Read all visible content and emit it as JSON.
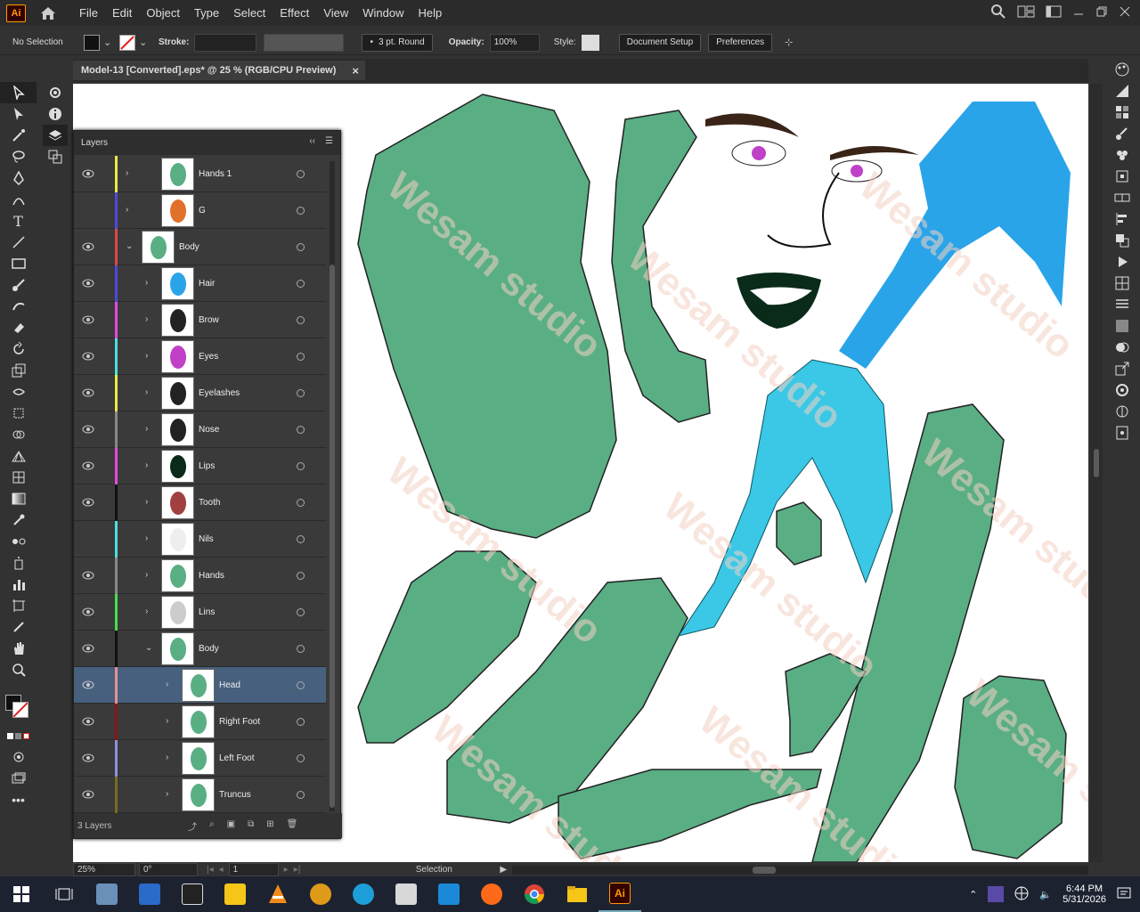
{
  "menu": {
    "logo": "Ai",
    "items": [
      "File",
      "Edit",
      "Object",
      "Type",
      "Select",
      "Effect",
      "View",
      "Window",
      "Help"
    ]
  },
  "control": {
    "selection": "No Selection",
    "stroke_label": "Stroke:",
    "brush_label": "3 pt. Round",
    "opacity_label": "Opacity:",
    "opacity_value": "100%",
    "style_label": "Style:",
    "document_setup": "Document Setup",
    "preferences": "Preferences"
  },
  "document": {
    "tab_title": "Model-13 [Converted].eps* @ 25 % (RGB/CPU Preview)",
    "close": "×"
  },
  "layers_panel": {
    "title": "Layers",
    "footer": "3 Layers",
    "rows": [
      {
        "name": "Hands 1",
        "color": "#e8e84a",
        "visible": true,
        "expanded": false,
        "selected": false
      },
      {
        "name": "G",
        "color": "#4a4adf",
        "visible": false,
        "expanded": false,
        "selected": false
      },
      {
        "name": "Body",
        "color": "#e04545",
        "visible": true,
        "expanded": true,
        "selected": false
      },
      {
        "name": "Hair",
        "color": "#4a4adf",
        "visible": true,
        "expanded": false,
        "selected": false
      },
      {
        "name": "Brow",
        "color": "#e04ae0",
        "visible": true,
        "expanded": false,
        "selected": false
      },
      {
        "name": "Eyes",
        "color": "#4ae0e0",
        "visible": true,
        "expanded": false,
        "selected": false
      },
      {
        "name": "Eyelashes",
        "color": "#e8e84a",
        "visible": true,
        "expanded": false,
        "selected": false
      },
      {
        "name": "Nose",
        "color": "#888888",
        "visible": true,
        "expanded": false,
        "selected": false
      },
      {
        "name": "Lips",
        "color": "#e04ae0",
        "visible": true,
        "expanded": false,
        "selected": false
      },
      {
        "name": "Tooth",
        "color": "#111111",
        "visible": true,
        "expanded": false,
        "selected": false
      },
      {
        "name": "Nils",
        "color": "#4ae0e0",
        "visible": false,
        "expanded": false,
        "selected": false
      },
      {
        "name": "Hands",
        "color": "#888888",
        "visible": true,
        "expanded": false,
        "selected": false
      },
      {
        "name": "Lins",
        "color": "#4ae04a",
        "visible": true,
        "expanded": false,
        "selected": false
      },
      {
        "name": "Body",
        "color": "#111111",
        "visible": true,
        "expanded": true,
        "selected": false
      },
      {
        "name": "Head",
        "color": "#e89090",
        "visible": true,
        "expanded": false,
        "selected": true
      },
      {
        "name": "Right Foot",
        "color": "#8a1515",
        "visible": true,
        "expanded": false,
        "selected": false
      },
      {
        "name": "Left Foot",
        "color": "#9090e0",
        "visible": true,
        "expanded": false,
        "selected": false
      },
      {
        "name": "Truncus",
        "color": "#7a6a20",
        "visible": true,
        "expanded": false,
        "selected": false
      }
    ]
  },
  "status": {
    "zoom": "25%",
    "rotation": "0°",
    "artboard": "1",
    "tool": "Selection"
  },
  "taskbar": {
    "time": "6:44 PM",
    "date": "5/31/2026"
  },
  "watermark": "Wesam studio",
  "colors": {
    "body_fill": "#5aae84",
    "hair_blue": "#2aa4e8",
    "accent": "#ff9a00"
  }
}
